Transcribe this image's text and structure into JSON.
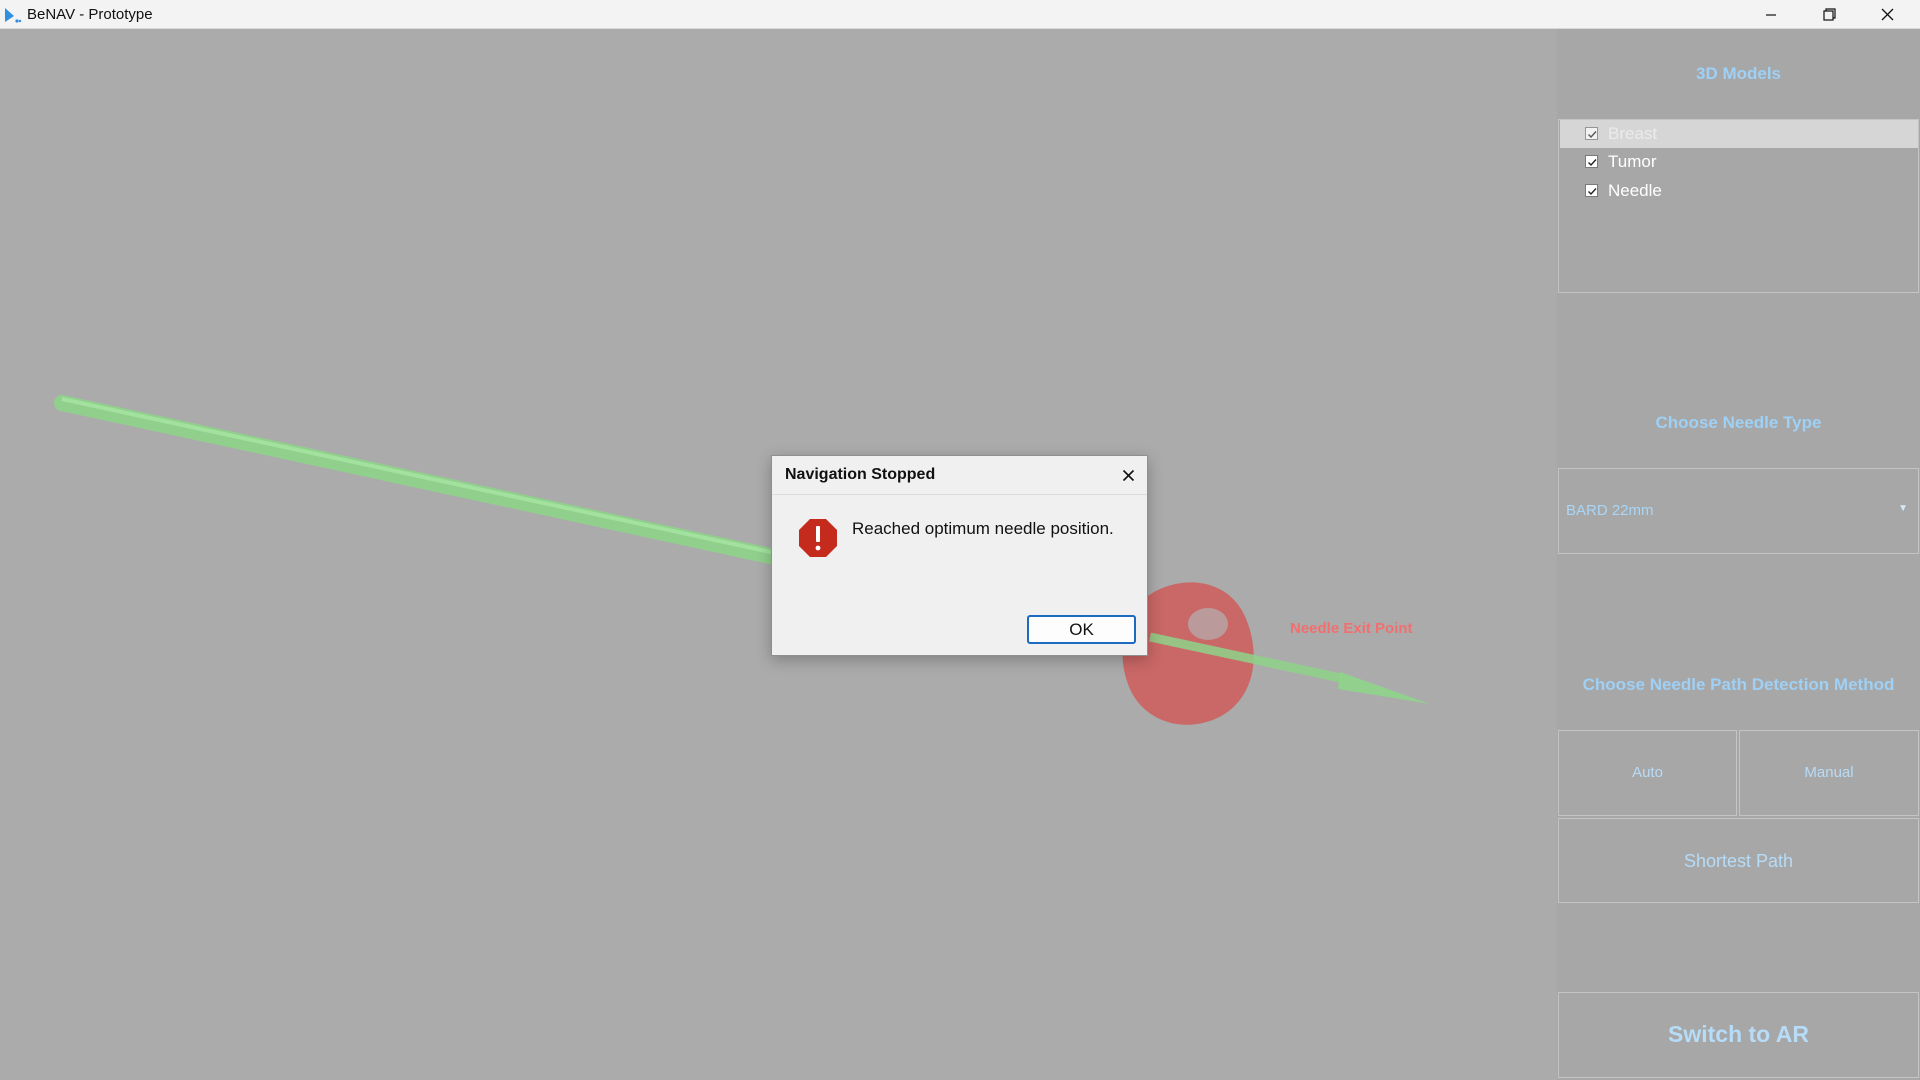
{
  "window": {
    "title": "BeNAV - Prototype",
    "icon": "benav-logo-icon",
    "controls": [
      "minimize-icon",
      "restore-icon",
      "close-icon"
    ]
  },
  "viewport": {
    "exit_label": "Needle Exit Point",
    "colors": {
      "needle": "#8fd48a",
      "tumor": "#d25757",
      "background": "#ababab"
    }
  },
  "panel": {
    "models_title": "3D Models",
    "models": [
      {
        "label": "Breast",
        "checked": true,
        "selected": true
      },
      {
        "label": "Tumor",
        "checked": true,
        "selected": false
      },
      {
        "label": "Needle",
        "checked": true,
        "selected": false
      }
    ],
    "needle_type_title": "Choose Needle Type",
    "needle_type_value": "BARD 22mm",
    "path_method_title": "Choose Needle Path Detection Method",
    "auto_label": "Auto",
    "manual_label": "Manual",
    "shortest_path_label": "Shortest Path",
    "switch_ar_label": "Switch to AR",
    "accent_color": "#9fd0f5"
  },
  "dialog": {
    "title": "Navigation Stopped",
    "message": "Reached optimum needle position.",
    "ok_label": "OK",
    "icon": "error-stop-icon",
    "icon_color": "#c42b1c"
  }
}
